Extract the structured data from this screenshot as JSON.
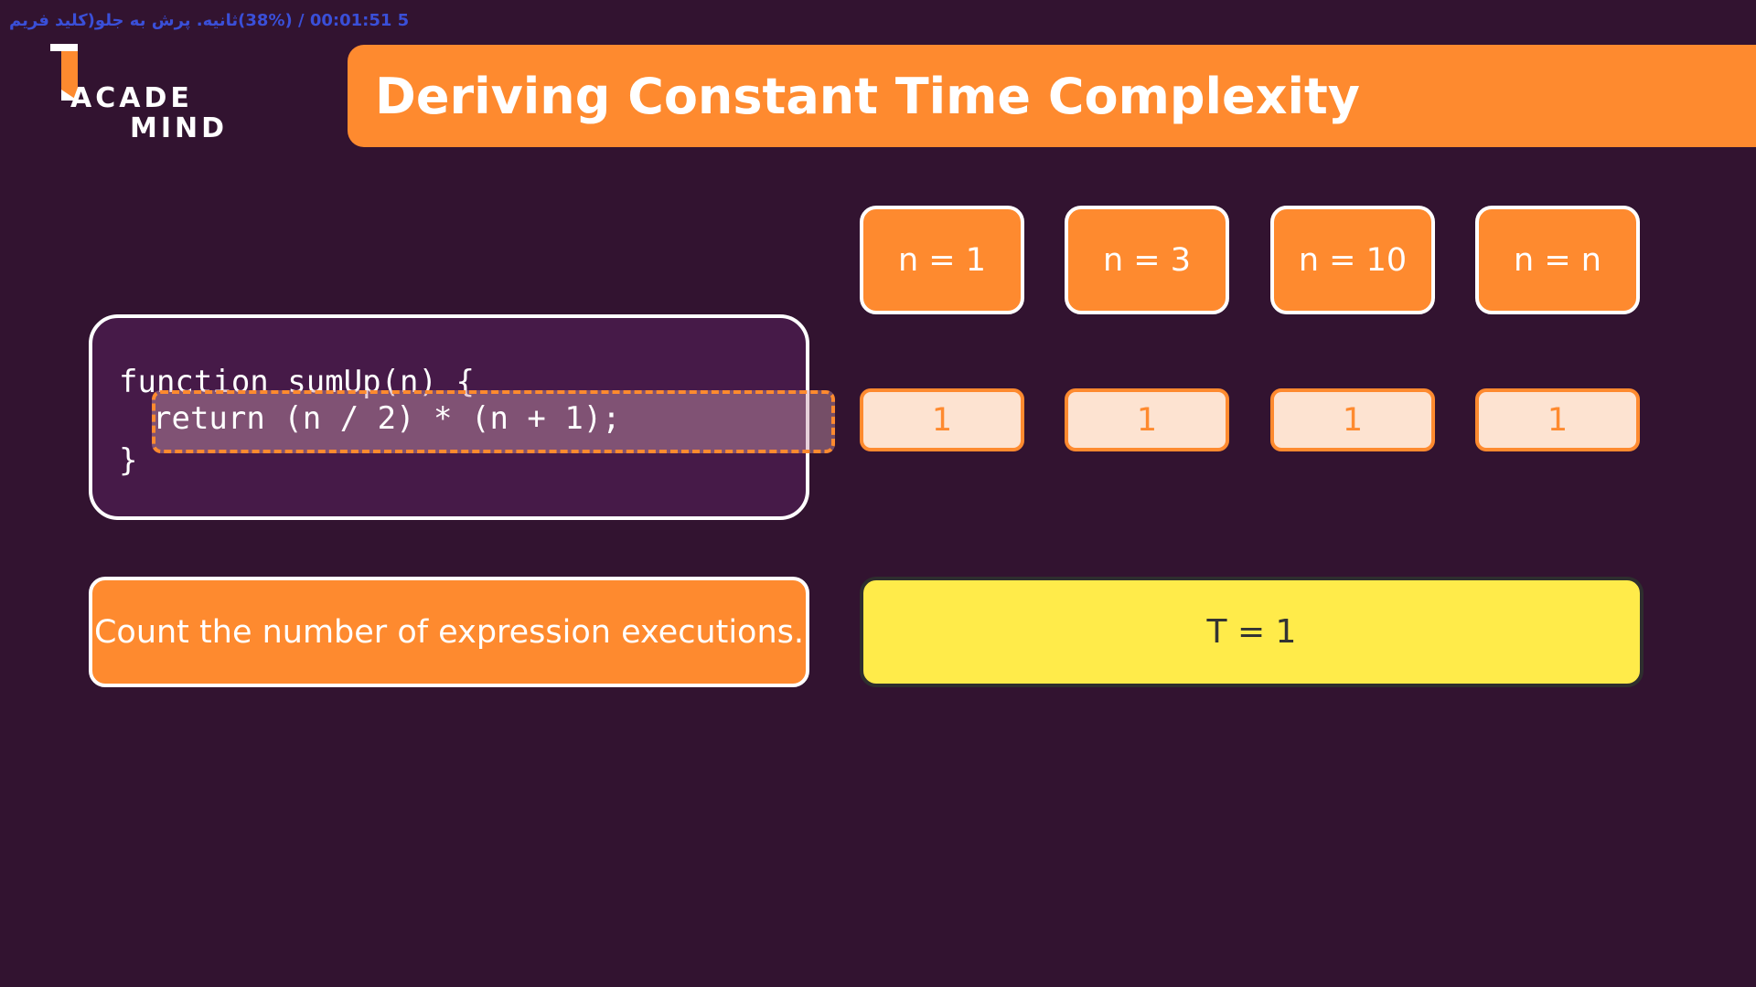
{
  "overlay": {
    "text": "5 00:01:51 / (38%)ثانیه. پرش به جلو(کلید فریم"
  },
  "logo": {
    "line1": "ACADE",
    "line2": "MIND"
  },
  "slide": {
    "title": "Deriving Constant Time Complexity",
    "inputs": [
      {
        "label": "n = 1",
        "count": "1"
      },
      {
        "label": "n = 3",
        "count": "1"
      },
      {
        "label": "n = 10",
        "count": "1"
      },
      {
        "label": "n = n",
        "count": "1"
      }
    ],
    "code": {
      "line1": "function sumUp(n) {",
      "line2": "return (n / 2) * (n + 1);",
      "line3": "}"
    },
    "instruction": "Count the number of expression executions.",
    "result": "T = 1"
  },
  "colors": {
    "background": "#321330",
    "accent": "#fe8a2f",
    "code_card": "#461a48",
    "count_fill": "#fde3d1",
    "result_fill": "#ffeb4a",
    "overlay_text": "#3a4fd8"
  }
}
